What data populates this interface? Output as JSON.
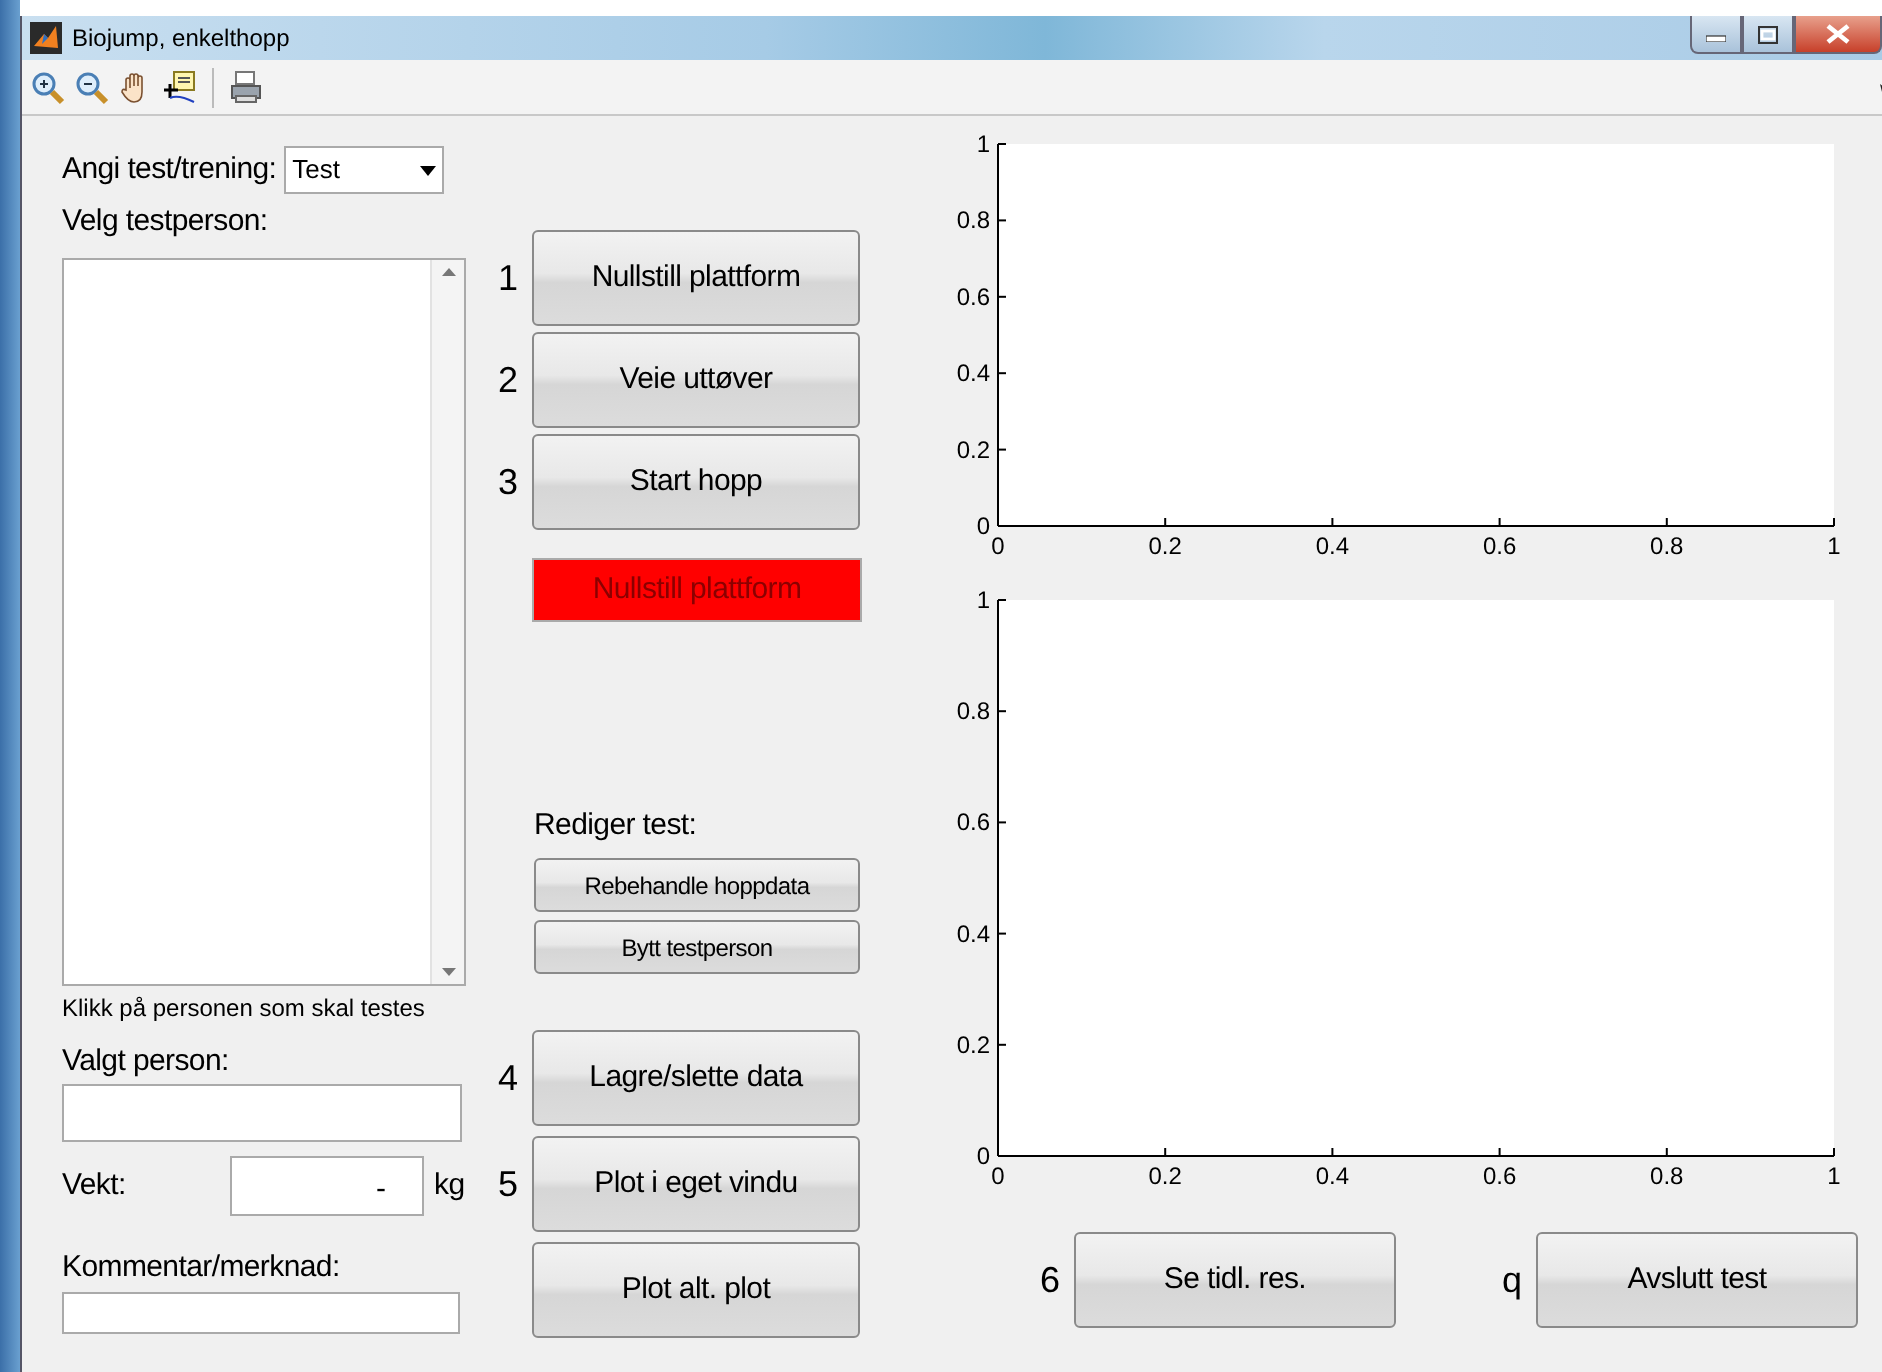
{
  "window": {
    "title": "Biojump, enkelthopp"
  },
  "left_panel": {
    "mode_label": "Angi test/trening:",
    "mode_select": {
      "value": "Test"
    },
    "person_list_label": "Velg testperson:",
    "person_list_hint": "Klikk på personen som skal testes",
    "selected_person_label": "Valgt person:",
    "weight": {
      "label": "Vekt:",
      "value": "-",
      "unit": "kg"
    },
    "comment_label": "Kommentar/merknad:"
  },
  "steps": [
    {
      "number": "1",
      "label": "Nullstill plattform"
    },
    {
      "number": "2",
      "label": "Veie uttøver"
    },
    {
      "number": "3",
      "label": "Start hopp"
    }
  ],
  "status_indicator": {
    "text": "Nullstill plattform"
  },
  "edit_section": {
    "title": "Rediger test:",
    "buttons": [
      "Rebehandle hoppdata",
      "Bytt testperson"
    ]
  },
  "output_steps": [
    {
      "number": "4",
      "label": "Lagre/slette data"
    },
    {
      "number": "5",
      "label": "Plot i eget vindu"
    },
    {
      "label": "Plot alt. plot"
    }
  ],
  "charts": [
    {
      "chart_data": {
        "type": "line",
        "xlim": [
          0,
          1
        ],
        "ylim": [
          0,
          1
        ],
        "xticks": [
          0,
          0.2,
          0.4,
          0.6,
          0.8,
          1
        ],
        "yticks": [
          0,
          0.2,
          0.4,
          0.6,
          0.8,
          1
        ]
      }
    },
    {
      "chart_data": {
        "type": "line",
        "xlim": [
          0,
          1
        ],
        "ylim": [
          0,
          1
        ],
        "xticks": [
          0,
          0.2,
          0.4,
          0.6,
          0.8,
          1
        ],
        "yticks": [
          0,
          0.2,
          0.4,
          0.6,
          0.8,
          1
        ]
      }
    }
  ],
  "bottom_buttons": [
    {
      "number": "6",
      "label": "Se tidl. res."
    },
    {
      "number": "q",
      "label": "Avslutt test"
    }
  ]
}
